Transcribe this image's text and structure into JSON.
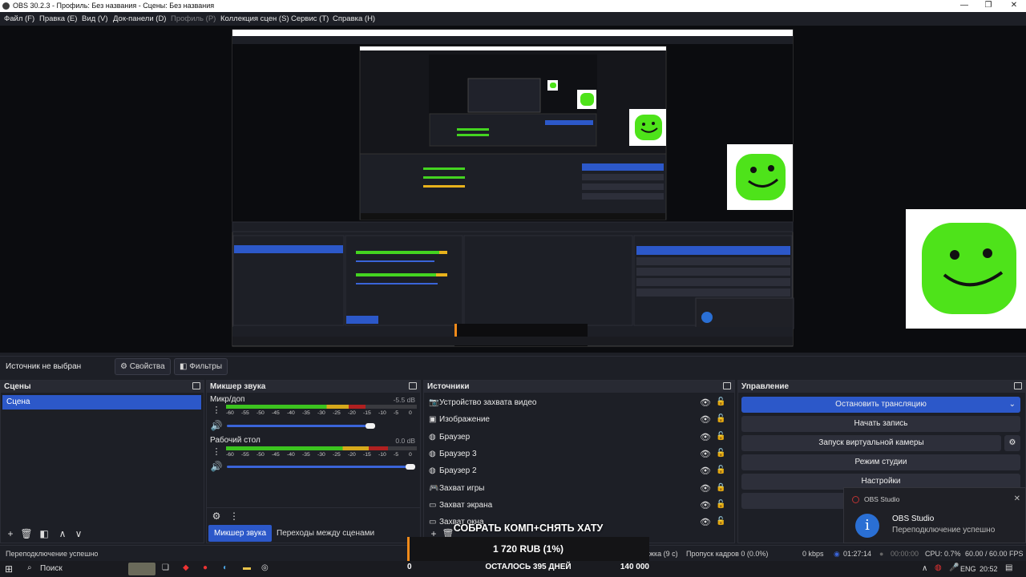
{
  "window": {
    "title": "OBS 30.2.3 - Профиль: Без названия - Сцены: Без названия",
    "controls": [
      "—",
      "❐",
      "✕"
    ]
  },
  "menu": {
    "items": [
      "Файл (F)",
      "Правка (E)",
      "Вид (V)",
      "Док-панели (D)",
      "Профиль (P)",
      "Коллекция сцен (S)",
      "Сервис (T)",
      "Справка (H)"
    ]
  },
  "source_bar": {
    "label": "Источник не выбран",
    "properties": "Свойства",
    "filters": "Фильтры"
  },
  "scenes": {
    "title": "Сцены",
    "items": [
      "Сцена"
    ]
  },
  "mixer": {
    "title": "Микшер звука",
    "ticks": [
      "-60",
      "-55",
      "-50",
      "-45",
      "-40",
      "-35",
      "-30",
      "-25",
      "-20",
      "-15",
      "-10",
      "-5",
      "0"
    ],
    "channels": [
      {
        "name": "Микр/доп",
        "db": "-5.5 dB",
        "level": 0.73,
        "volume": 0.98
      },
      {
        "name": "Рабочий стол",
        "db": "0.0 dB",
        "level": 0.85,
        "volume": 1.0
      }
    ],
    "tab_mixer": "Микшер звука",
    "tab_transitions": "Переходы между сценами"
  },
  "sources": {
    "title": "Источники",
    "items": [
      {
        "name": "Устройство захвата видео",
        "icon": "camera-icon",
        "glyph": "📷",
        "locked": false
      },
      {
        "name": "Изображение",
        "icon": "image-icon",
        "glyph": "▣",
        "locked": false
      },
      {
        "name": "Браузер",
        "icon": "globe-icon",
        "glyph": "◍",
        "locked": false
      },
      {
        "name": "Браузер 3",
        "icon": "globe-icon",
        "glyph": "◍",
        "locked": false
      },
      {
        "name": "Браузер 2",
        "icon": "globe-icon",
        "glyph": "◍",
        "locked": false
      },
      {
        "name": "Захват игры",
        "icon": "gamepad-icon",
        "glyph": "🎮",
        "locked": true
      },
      {
        "name": "Захват экрана",
        "icon": "monitor-icon",
        "glyph": "▭",
        "locked": false
      },
      {
        "name": "Захват окна",
        "icon": "window-icon",
        "glyph": "▭",
        "locked": false
      }
    ]
  },
  "controls": {
    "title": "Управление",
    "stop_stream": "Остановить трансляцию",
    "start_record": "Начать запись",
    "virtual_camera": "Запуск виртуальной камеры",
    "studio_mode": "Режим студии",
    "settings": "Настройки"
  },
  "status": {
    "message": "Переподключение успешно",
    "dropped_prefix": "жка (9 с)",
    "dropped": "Пропуск кадров 0 (0.0%)",
    "kbps": "0 kbps",
    "stream_time": "01:27:14",
    "rec_time": "00:00:00",
    "cpu": "CPU: 0.7%",
    "fps": "60.00 / 60.00 FPS"
  },
  "toast": {
    "app": "OBS Studio",
    "title": "OBS Studio",
    "body": "Переподключение успешно"
  },
  "donation": {
    "title": "СОБРАТЬ КОМП+СНЯТЬ ХАТУ",
    "amount": "1 720 RUB (1%)",
    "min": "0",
    "remaining": "ОСТАЛОСЬ 395 ДНЕЙ",
    "goal": "140 000",
    "progress": 0.01
  },
  "taskbar": {
    "search": "Поиск",
    "lang": "ENG",
    "time": "20:52"
  },
  "colors": {
    "accent": "#2c58c9",
    "bg": "#1d1f26",
    "frog": "#4ee31a"
  }
}
